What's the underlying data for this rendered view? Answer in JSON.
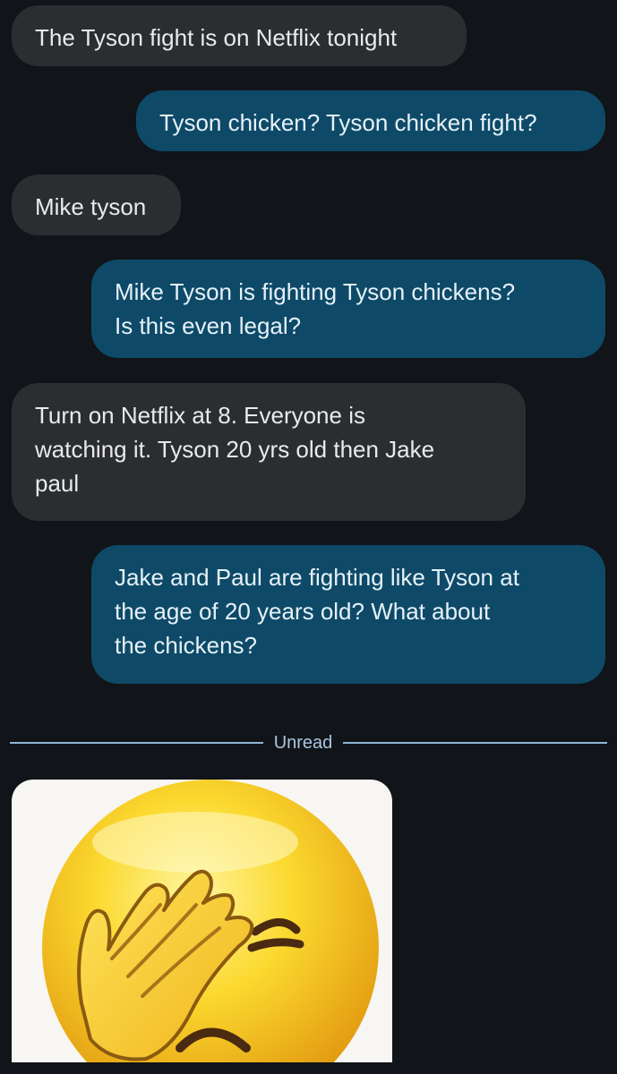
{
  "conversation": {
    "messages": [
      {
        "direction": "incoming",
        "text": "The Tyson fight is on Netflix tonight"
      },
      {
        "direction": "outgoing",
        "text": "Tyson chicken? Tyson chicken fight?"
      },
      {
        "direction": "incoming",
        "text": "Mike tyson"
      },
      {
        "direction": "outgoing",
        "text": "Mike Tyson is fighting Tyson chickens?\nIs this even legal?"
      },
      {
        "direction": "incoming",
        "text": "Turn on Netflix at 8. Everyone is\nwatching it. Tyson 20 yrs old then Jake\npaul"
      },
      {
        "direction": "outgoing",
        "text": "Jake and Paul are fighting like Tyson at\nthe age of 20 years old? What about\nthe chickens?"
      }
    ],
    "unread_divider_label": "Unread",
    "attachment": {
      "type": "image",
      "icon": "facepalm-emoji-icon"
    }
  },
  "colors": {
    "background": "#111418",
    "incoming_bubble": "#2b2d31",
    "outgoing_bubble": "#0e4a68",
    "divider": "#8fb6d8"
  }
}
